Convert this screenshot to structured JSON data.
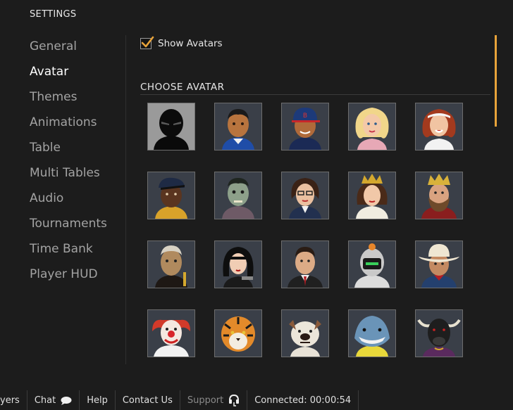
{
  "header": {
    "title": "SETTINGS"
  },
  "sidebar": {
    "items": [
      {
        "label": "General",
        "active": false
      },
      {
        "label": "Avatar",
        "active": true
      },
      {
        "label": "Themes",
        "active": false
      },
      {
        "label": "Animations",
        "active": false
      },
      {
        "label": "Table",
        "active": false
      },
      {
        "label": "Multi Tables",
        "active": false
      },
      {
        "label": "Audio",
        "active": false
      },
      {
        "label": "Tournaments",
        "active": false
      },
      {
        "label": "Time Bank",
        "active": false
      },
      {
        "label": "Player HUD",
        "active": false
      }
    ]
  },
  "avatar_panel": {
    "show_avatars_label": "Show Avatars",
    "show_avatars_checked": true,
    "choose_title": "CHOOSE AVATAR",
    "avatars": [
      "ninja-avatar",
      "soccer-player-avatar",
      "baseball-player-avatar",
      "blonde-woman-avatar",
      "redhead-woman-avatar",
      "rapper-avatar",
      "zombie-avatar",
      "businesswoman-avatar",
      "queen-avatar",
      "king-avatar",
      "old-man-avatar",
      "gun-woman-avatar",
      "businessman-avatar",
      "astronaut-robot-avatar",
      "cowboy-avatar",
      "clown-avatar",
      "tiger-avatar",
      "bulldog-avatar",
      "shark-avatar",
      "bull-avatar"
    ]
  },
  "footer": {
    "items": [
      {
        "label": "yers",
        "icon": ""
      },
      {
        "label": "Chat",
        "icon": "chat-bubble-icon"
      },
      {
        "label": "Help",
        "icon": ""
      },
      {
        "label": "Contact Us",
        "icon": ""
      },
      {
        "label": "Support",
        "icon": "headset-icon"
      },
      {
        "label": "Connected: 00:00:54",
        "icon": ""
      }
    ]
  },
  "colors": {
    "accent": "#e8a33a",
    "background": "#1c1c1c"
  }
}
